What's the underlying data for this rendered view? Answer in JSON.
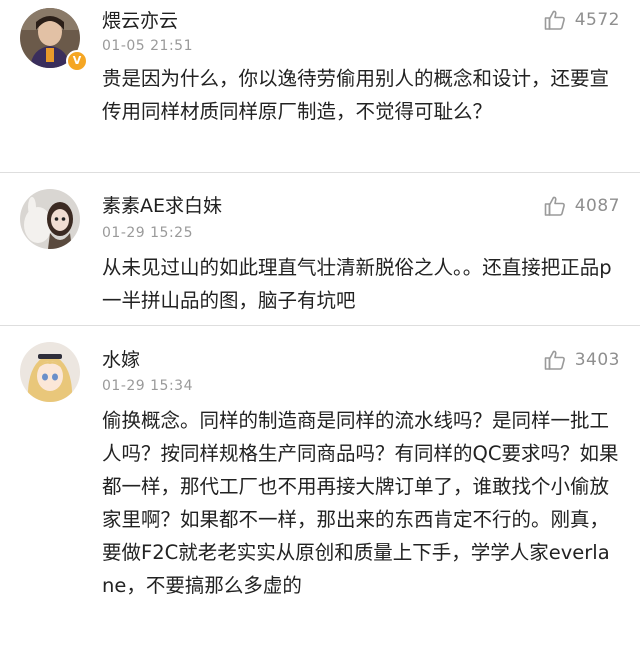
{
  "comments": [
    {
      "username": "煨云亦云",
      "time": "01-05 21:51",
      "likes": "4572",
      "text": "贵是因为什么，你以逸待劳偷用别人的概念和设计，还要宣传用同样材质同样原厂制造，不觉得可耻么？",
      "verified": true
    },
    {
      "username": "素素AE求白妹",
      "time": "01-29 15:25",
      "likes": "4087",
      "text": "从未见过山的如此理直气壮清新脱俗之人。。还直接把正品p一半拼山品的图，脑子有坑吧"
    },
    {
      "username": "水嫁",
      "time": "01-29 15:34",
      "likes": "3403",
      "text": "偷换概念。同样的制造商是同样的流水线吗？是同样一批工人吗？按同样规格生产同商品吗？有同样的QC要求吗？如果都一样，那代工厂也不用再接大牌订单了，谁敢找个小偷放家里啊？如果都不一样，那出来的东西肯定不行的。刚真，要做F2C就老老实实从原创和质量上下手，学学人家everlane，不要搞那么多虚的"
    }
  ],
  "colors": {
    "verified_badge": "#f5a623",
    "username": "#1f1f1f",
    "meta": "#9a9a9a",
    "divider": "#dedede"
  },
  "icons": {
    "like": "thumbs-up-icon",
    "verified": "verified-badge-icon"
  }
}
